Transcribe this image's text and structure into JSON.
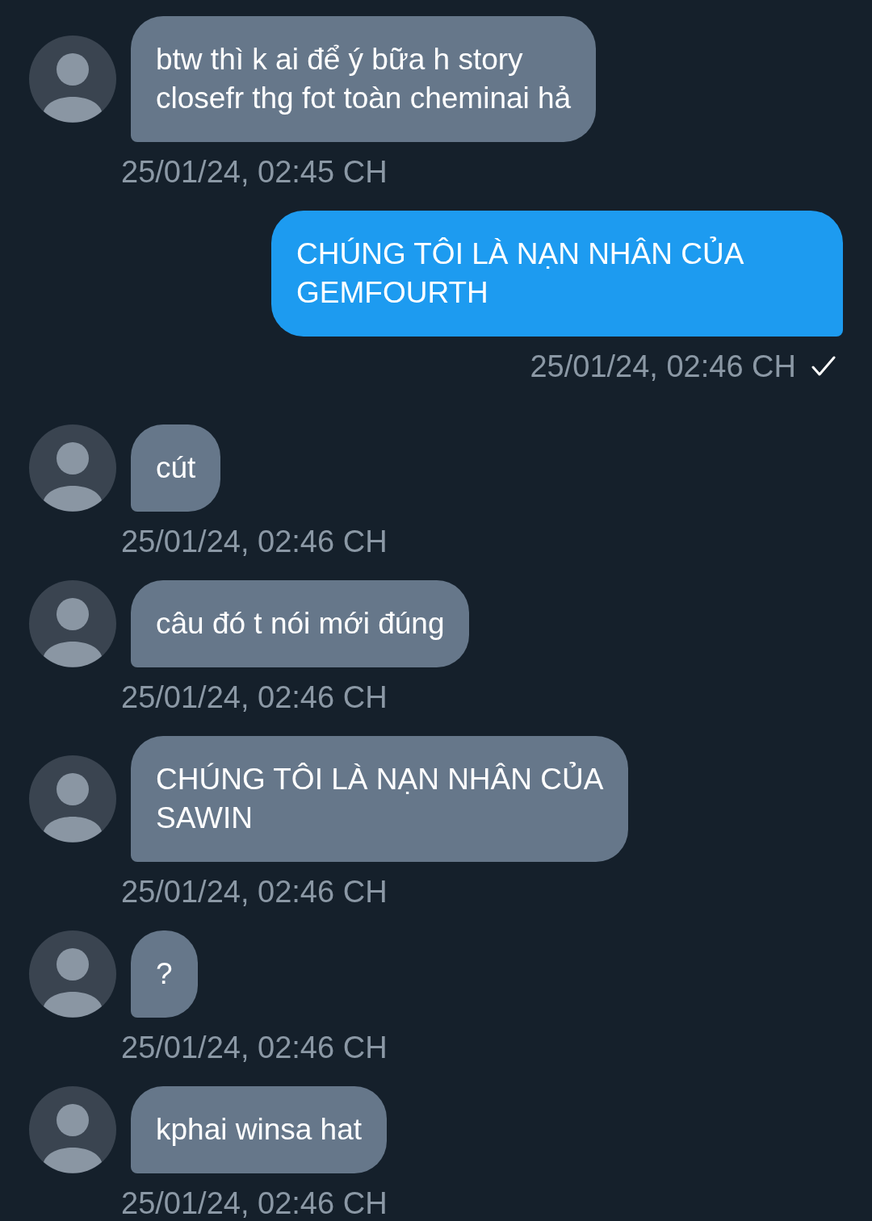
{
  "messages": [
    {
      "kind": "received",
      "text": "btw thì k ai để ý bữa h story\nclosefr thg fot toàn cheminai hả",
      "time": "25/01/24, 02:45 CH"
    },
    {
      "kind": "sent",
      "text": "CHÚNG TÔI LÀ NẠN NHÂN CỦA\nGEMFOURTH",
      "time": "25/01/24, 02:46 CH",
      "checked": true
    },
    {
      "kind": "received",
      "text": "cút",
      "time": "25/01/24, 02:46 CH"
    },
    {
      "kind": "received",
      "text": "câu đó t nói mới đúng",
      "time": "25/01/24, 02:46 CH"
    },
    {
      "kind": "received",
      "text": "CHÚNG TÔI LÀ NẠN NHÂN CỦA\nSAWIN",
      "time": "25/01/24, 02:46 CH"
    },
    {
      "kind": "received",
      "text": "?",
      "time": "25/01/24, 02:46 CH"
    },
    {
      "kind": "received",
      "text": "kphai winsa hat",
      "time": "25/01/24, 02:46 CH"
    }
  ]
}
